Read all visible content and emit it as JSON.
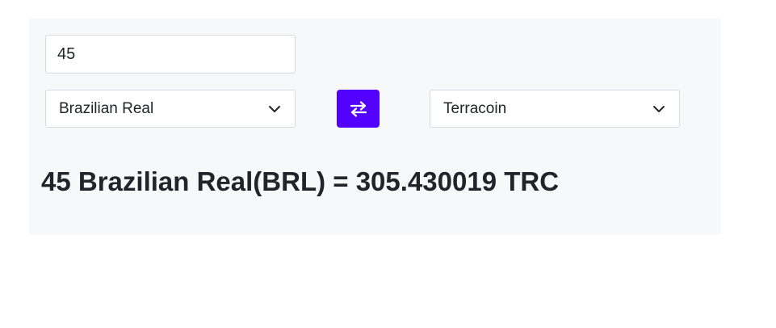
{
  "converter": {
    "amount_value": "45",
    "from_currency": "Brazilian Real",
    "to_currency": "Terracoin",
    "result_text": "45 Brazilian Real(BRL) = 305.430019 TRC"
  },
  "colors": {
    "accent": "#5200ff",
    "panel_bg": "#f7f8fa",
    "border": "#d9d9e1",
    "text": "#212529"
  },
  "icons": {
    "swap": "swap-arrows-icon",
    "dropdown": "chevron-down-icon"
  }
}
